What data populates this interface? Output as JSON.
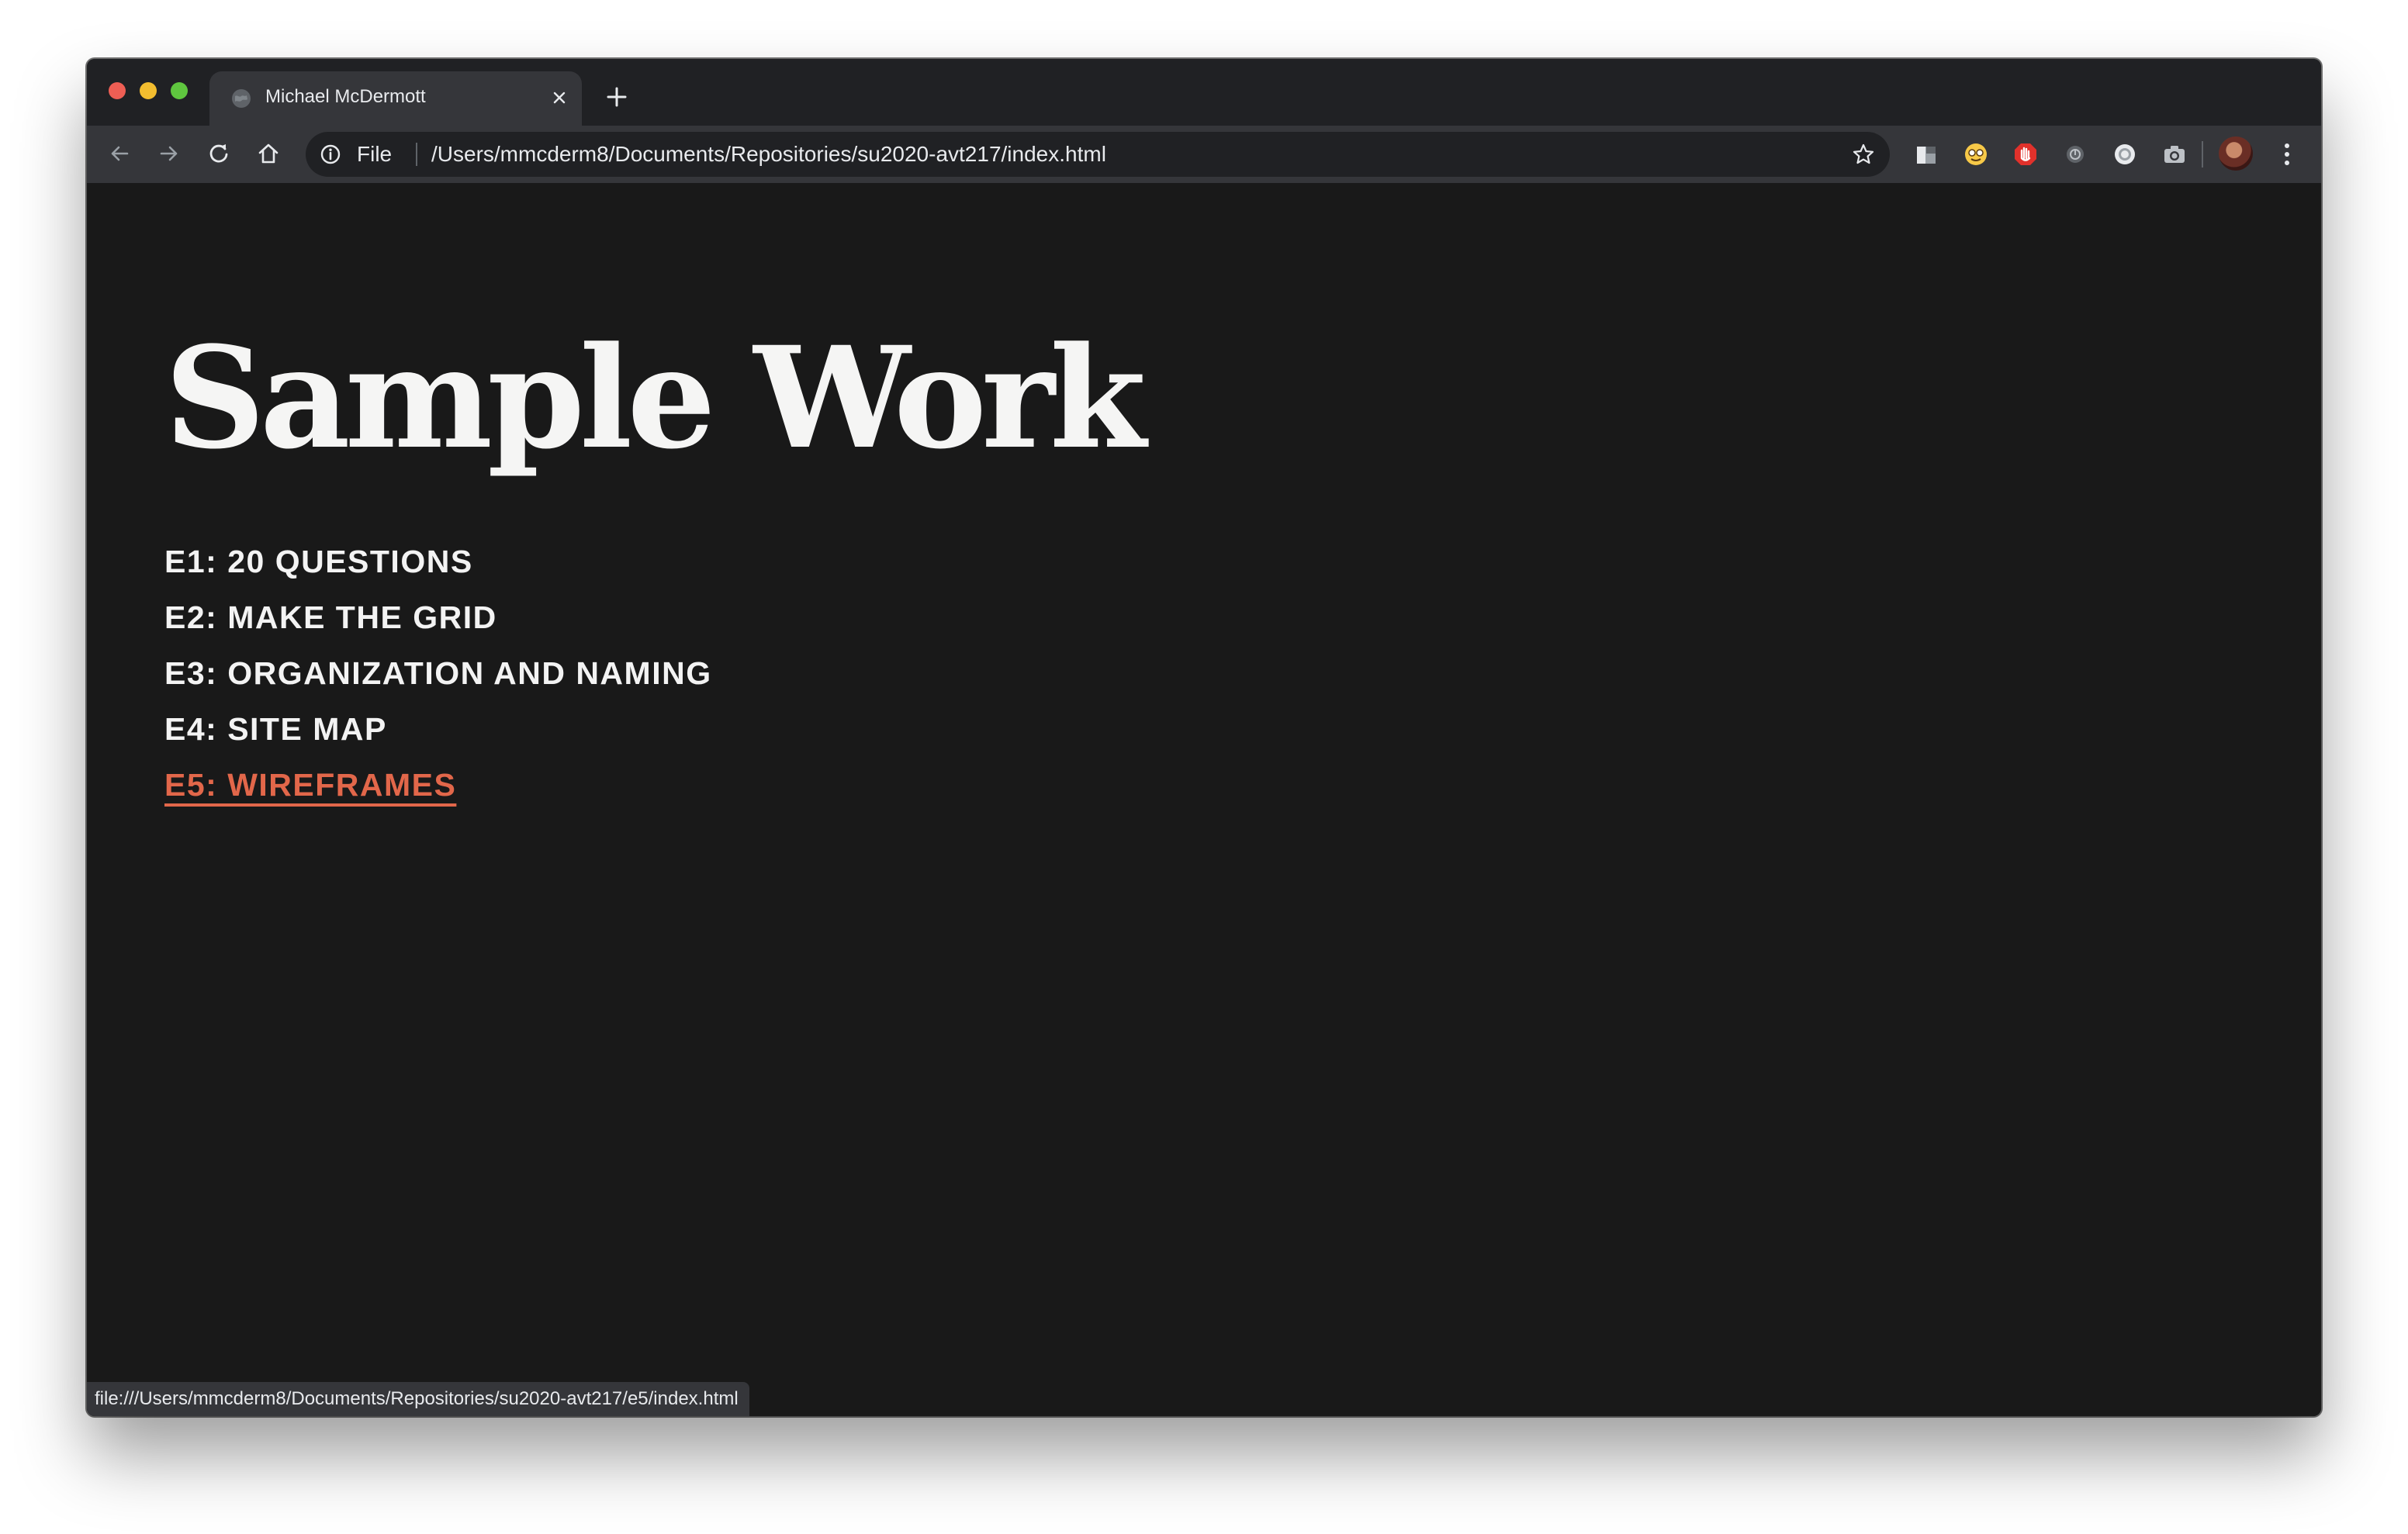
{
  "browser": {
    "tab": {
      "title": "Michael McDermott"
    },
    "omnibox": {
      "scheme_label": "File",
      "url": "/Users/mmcderm8/Documents/Repositories/su2020-avt217/index.html"
    },
    "extensions": [
      "extension-icon-1",
      "extension-icon-2",
      "extension-icon-3",
      "extension-icon-4",
      "extension-icon-5",
      "camera-icon"
    ],
    "status_url": "file:///Users/mmcderm8/Documents/Repositories/su2020-avt217/e5/index.html"
  },
  "page": {
    "title": "Sample Work",
    "links": [
      {
        "label": "E1: 20 QUESTIONS",
        "active": false
      },
      {
        "label": "E2: MAKE THE GRID",
        "active": false
      },
      {
        "label": "E3: ORGANIZATION AND NAMING",
        "active": false
      },
      {
        "label": "E4: SITE MAP",
        "active": false
      },
      {
        "label": "E5: WIREFRAMES",
        "active": true
      }
    ],
    "colors": {
      "background": "#191919",
      "text": "#f5f5f4",
      "active_link": "#e2674a"
    }
  }
}
